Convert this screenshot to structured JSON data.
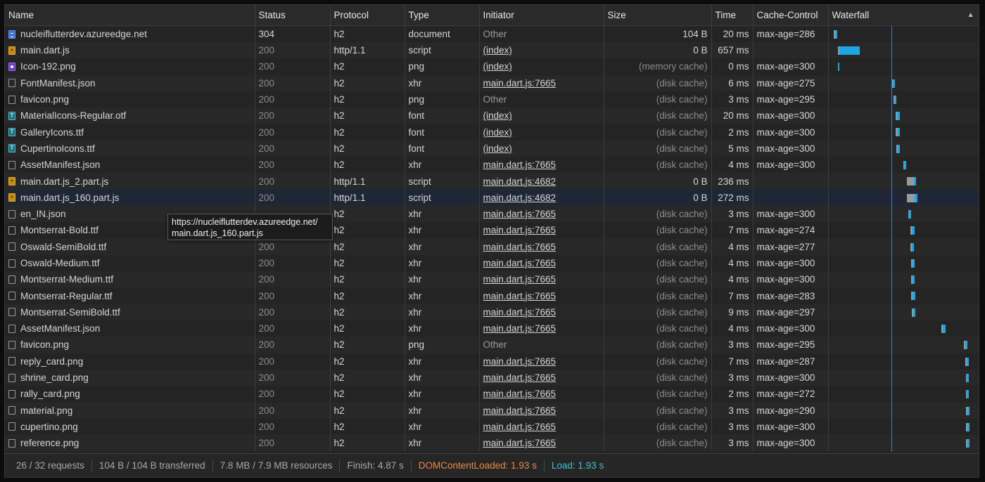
{
  "columns": [
    "Name",
    "Status",
    "Protocol",
    "Type",
    "Initiator",
    "Size",
    "Time",
    "Cache-Control",
    "Waterfall"
  ],
  "rows": [
    {
      "name": "nucleiflutterdev.azureedge.net",
      "icon": "doc",
      "status": "304",
      "protocol": "h2",
      "type": "document",
      "initiator": "Other",
      "init_link": false,
      "size": "104 B",
      "size_dim": false,
      "time": "20 ms",
      "cache": "max-age=286",
      "wf": [
        {
          "k": "wait",
          "s": 1182,
          "w": 2
        },
        {
          "k": "dl",
          "s": 1184,
          "w": 3
        }
      ]
    },
    {
      "name": "main.dart.js",
      "icon": "script",
      "status": "200",
      "protocol": "http/1.1",
      "type": "script",
      "initiator": "(index)",
      "init_link": true,
      "size": "0 B",
      "size_dim": false,
      "time": "657 ms",
      "cache": "",
      "wf": [
        {
          "k": "wait",
          "s": 1188,
          "w": 2
        },
        {
          "k": "dl",
          "s": 1190,
          "w": 29
        }
      ]
    },
    {
      "name": "Icon-192.png",
      "icon": "img",
      "status": "200",
      "protocol": "h2",
      "type": "png",
      "initiator": "(index)",
      "init_link": true,
      "size": "(memory cache)",
      "size_dim": true,
      "time": "0 ms",
      "cache": "max-age=300",
      "wf": [
        {
          "k": "dl",
          "s": 1188,
          "w": 2
        }
      ]
    },
    {
      "name": "FontManifest.json",
      "icon": "plain",
      "status": "200",
      "protocol": "h2",
      "type": "xhr",
      "initiator": "main.dart.js:7665",
      "init_link": true,
      "size": "(disk cache)",
      "size_dim": true,
      "time": "6 ms",
      "cache": "max-age=275",
      "wf": [
        {
          "k": "wait",
          "s": 1264,
          "w": 2
        },
        {
          "k": "dl",
          "s": 1266,
          "w": 3
        }
      ]
    },
    {
      "name": "favicon.png",
      "icon": "plain",
      "status": "200",
      "protocol": "h2",
      "type": "png",
      "initiator": "Other",
      "init_link": false,
      "size": "(disk cache)",
      "size_dim": true,
      "time": "3 ms",
      "cache": "max-age=295",
      "wf": [
        {
          "k": "wait",
          "s": 1267,
          "w": 2
        },
        {
          "k": "dl",
          "s": 1269,
          "w": 2
        }
      ]
    },
    {
      "name": "MaterialIcons-Regular.otf",
      "icon": "font",
      "status": "200",
      "protocol": "h2",
      "type": "font",
      "initiator": "(index)",
      "init_link": true,
      "size": "(disk cache)",
      "size_dim": true,
      "time": "20 ms",
      "cache": "max-age=300",
      "wf": [
        {
          "k": "wait",
          "s": 1270,
          "w": 2
        },
        {
          "k": "dl",
          "s": 1272,
          "w": 4
        }
      ]
    },
    {
      "name": "GalleryIcons.ttf",
      "icon": "font",
      "status": "200",
      "protocol": "h2",
      "type": "font",
      "initiator": "(index)",
      "init_link": true,
      "size": "(disk cache)",
      "size_dim": true,
      "time": "2 ms",
      "cache": "max-age=300",
      "wf": [
        {
          "k": "wait",
          "s": 1270,
          "w": 3
        },
        {
          "k": "dl",
          "s": 1273,
          "w": 3
        }
      ]
    },
    {
      "name": "CupertinoIcons.ttf",
      "icon": "font",
      "status": "200",
      "protocol": "h2",
      "type": "font",
      "initiator": "(index)",
      "init_link": true,
      "size": "(disk cache)",
      "size_dim": true,
      "time": "5 ms",
      "cache": "max-age=300",
      "wf": [
        {
          "k": "wait",
          "s": 1271,
          "w": 2
        },
        {
          "k": "dl",
          "s": 1273,
          "w": 3
        }
      ]
    },
    {
      "name": "AssetManifest.json",
      "icon": "plain",
      "status": "200",
      "protocol": "h2",
      "type": "xhr",
      "initiator": "main.dart.js:7665",
      "init_link": true,
      "size": "(disk cache)",
      "size_dim": true,
      "time": "4 ms",
      "cache": "max-age=300",
      "wf": [
        {
          "k": "wait",
          "s": 1281,
          "w": 1
        },
        {
          "k": "dl",
          "s": 1282,
          "w": 3
        }
      ]
    },
    {
      "name": "main.dart.js_2.part.js",
      "icon": "script",
      "status": "200",
      "protocol": "http/1.1",
      "type": "script",
      "initiator": "main.dart.js:4682",
      "init_link": true,
      "size": "0 B",
      "size_dim": false,
      "time": "236 ms",
      "cache": "",
      "wf": [
        {
          "k": "wait",
          "s": 1286,
          "w": 10
        },
        {
          "k": "dl",
          "s": 1296,
          "w": 3
        }
      ]
    },
    {
      "name": "main.dart.js_160.part.js",
      "icon": "script",
      "status": "200",
      "protocol": "http/1.1",
      "type": "script",
      "initiator": "main.dart.js:4682",
      "init_link": true,
      "size": "0 B",
      "size_dim": false,
      "time": "272 ms",
      "cache": "",
      "selected": true,
      "wf": [
        {
          "k": "wait",
          "s": 1286,
          "w": 11
        },
        {
          "k": "dl",
          "s": 1297,
          "w": 4
        }
      ]
    },
    {
      "name": "en_IN.json",
      "icon": "plain",
      "status": "",
      "protocol": "h2",
      "type": "xhr",
      "initiator": "main.dart.js:7665",
      "init_link": true,
      "size": "(disk cache)",
      "size_dim": true,
      "time": "3 ms",
      "cache": "max-age=300",
      "wf": [
        {
          "k": "wait",
          "s": 1288,
          "w": 1
        },
        {
          "k": "dl",
          "s": 1289,
          "w": 3
        }
      ]
    },
    {
      "name": "Montserrat-Bold.ttf",
      "icon": "plain",
      "status": "",
      "protocol": "h2",
      "type": "xhr",
      "initiator": "main.dart.js:7665",
      "init_link": true,
      "size": "(disk cache)",
      "size_dim": true,
      "time": "7 ms",
      "cache": "max-age=274",
      "wf": [
        {
          "k": "wait",
          "s": 1291,
          "w": 2
        },
        {
          "k": "dl",
          "s": 1293,
          "w": 4
        }
      ]
    },
    {
      "name": "Oswald-SemiBold.ttf",
      "icon": "plain",
      "status": "200",
      "protocol": "h2",
      "type": "xhr",
      "initiator": "main.dart.js:7665",
      "init_link": true,
      "size": "(disk cache)",
      "size_dim": true,
      "time": "4 ms",
      "cache": "max-age=277",
      "wf": [
        {
          "k": "wait",
          "s": 1291,
          "w": 2
        },
        {
          "k": "dl",
          "s": 1293,
          "w": 3
        }
      ]
    },
    {
      "name": "Oswald-Medium.ttf",
      "icon": "plain",
      "status": "200",
      "protocol": "h2",
      "type": "xhr",
      "initiator": "main.dart.js:7665",
      "init_link": true,
      "size": "(disk cache)",
      "size_dim": true,
      "time": "4 ms",
      "cache": "max-age=300",
      "wf": [
        {
          "k": "wait",
          "s": 1292,
          "w": 2
        },
        {
          "k": "dl",
          "s": 1294,
          "w": 3
        }
      ]
    },
    {
      "name": "Montserrat-Medium.ttf",
      "icon": "plain",
      "status": "200",
      "protocol": "h2",
      "type": "xhr",
      "initiator": "main.dart.js:7665",
      "init_link": true,
      "size": "(disk cache)",
      "size_dim": true,
      "time": "4 ms",
      "cache": "max-age=300",
      "wf": [
        {
          "k": "wait",
          "s": 1292,
          "w": 2
        },
        {
          "k": "dl",
          "s": 1294,
          "w": 3
        }
      ]
    },
    {
      "name": "Montserrat-Regular.ttf",
      "icon": "plain",
      "status": "200",
      "protocol": "h2",
      "type": "xhr",
      "initiator": "main.dart.js:7665",
      "init_link": true,
      "size": "(disk cache)",
      "size_dim": true,
      "time": "7 ms",
      "cache": "max-age=283",
      "wf": [
        {
          "k": "wait",
          "s": 1292,
          "w": 2
        },
        {
          "k": "dl",
          "s": 1294,
          "w": 4
        }
      ]
    },
    {
      "name": "Montserrat-SemiBold.ttf",
      "icon": "plain",
      "status": "200",
      "protocol": "h2",
      "type": "xhr",
      "initiator": "main.dart.js:7665",
      "init_link": true,
      "size": "(disk cache)",
      "size_dim": true,
      "time": "9 ms",
      "cache": "max-age=297",
      "wf": [
        {
          "k": "wait",
          "s": 1293,
          "w": 2
        },
        {
          "k": "dl",
          "s": 1295,
          "w": 3
        }
      ]
    },
    {
      "name": "AssetManifest.json",
      "icon": "plain",
      "status": "200",
      "protocol": "h2",
      "type": "xhr",
      "initiator": "main.dart.js:7665",
      "init_link": true,
      "size": "(disk cache)",
      "size_dim": true,
      "time": "4 ms",
      "cache": "max-age=300",
      "wf": [
        {
          "k": "wait",
          "s": 1335,
          "w": 2
        },
        {
          "k": "dl",
          "s": 1337,
          "w": 4
        }
      ]
    },
    {
      "name": "favicon.png",
      "icon": "plain",
      "status": "200",
      "protocol": "h2",
      "type": "png",
      "initiator": "Other",
      "init_link": false,
      "size": "(disk cache)",
      "size_dim": true,
      "time": "3 ms",
      "cache": "max-age=295",
      "wf": [
        {
          "k": "wait",
          "s": 1367,
          "w": 2
        },
        {
          "k": "dl",
          "s": 1369,
          "w": 3
        }
      ]
    },
    {
      "name": "reply_card.png",
      "icon": "plain",
      "status": "200",
      "protocol": "h2",
      "type": "xhr",
      "initiator": "main.dart.js:7665",
      "init_link": true,
      "size": "(disk cache)",
      "size_dim": true,
      "time": "7 ms",
      "cache": "max-age=287",
      "wf": [
        {
          "k": "wait",
          "s": 1369,
          "w": 2
        },
        {
          "k": "dl",
          "s": 1371,
          "w": 3
        }
      ]
    },
    {
      "name": "shrine_card.png",
      "icon": "plain",
      "status": "200",
      "protocol": "h2",
      "type": "xhr",
      "initiator": "main.dart.js:7665",
      "init_link": true,
      "size": "(disk cache)",
      "size_dim": true,
      "time": "3 ms",
      "cache": "max-age=300",
      "wf": [
        {
          "k": "wait",
          "s": 1370,
          "w": 1
        },
        {
          "k": "dl",
          "s": 1371,
          "w": 3
        }
      ]
    },
    {
      "name": "rally_card.png",
      "icon": "plain",
      "status": "200",
      "protocol": "h2",
      "type": "xhr",
      "initiator": "main.dart.js:7665",
      "init_link": true,
      "size": "(disk cache)",
      "size_dim": true,
      "time": "2 ms",
      "cache": "max-age=272",
      "wf": [
        {
          "k": "wait",
          "s": 1370,
          "w": 1
        },
        {
          "k": "dl",
          "s": 1371,
          "w": 3
        }
      ]
    },
    {
      "name": "material.png",
      "icon": "plain",
      "status": "200",
      "protocol": "h2",
      "type": "xhr",
      "initiator": "main.dart.js:7665",
      "init_link": true,
      "size": "(disk cache)",
      "size_dim": true,
      "time": "3 ms",
      "cache": "max-age=290",
      "wf": [
        {
          "k": "wait",
          "s": 1370,
          "w": 2
        },
        {
          "k": "dl",
          "s": 1372,
          "w": 3
        }
      ]
    },
    {
      "name": "cupertino.png",
      "icon": "plain",
      "status": "200",
      "protocol": "h2",
      "type": "xhr",
      "initiator": "main.dart.js:7665",
      "init_link": true,
      "size": "(disk cache)",
      "size_dim": true,
      "time": "3 ms",
      "cache": "max-age=300",
      "wf": [
        {
          "k": "wait",
          "s": 1370,
          "w": 2
        },
        {
          "k": "dl",
          "s": 1372,
          "w": 3
        }
      ]
    },
    {
      "name": "reference.png",
      "icon": "plain",
      "status": "200",
      "protocol": "h2",
      "type": "xhr",
      "initiator": "main.dart.js:7665",
      "init_link": true,
      "size": "(disk cache)",
      "size_dim": true,
      "time": "3 ms",
      "cache": "max-age=300",
      "wf": [
        {
          "k": "wait",
          "s": 1370,
          "w": 2
        },
        {
          "k": "dl",
          "s": 1372,
          "w": 3
        }
      ]
    }
  ],
  "tooltip": {
    "line1": "https://nucleiflutterdev.azureedge.net/",
    "line2": "main.dart.js_160.part.js"
  },
  "footer": {
    "requests": "26 / 32 requests",
    "transferred": "104 B / 104 B transferred",
    "resources": "7.8 MB / 7.9 MB resources",
    "finish": "Finish: 4.87 s",
    "dcl": "DOMContentLoaded: 1.93 s",
    "load": "Load: 1.93 s"
  },
  "colors": {
    "dcl": "#e88c4a",
    "load": "#3fc0d8",
    "waterfall_download": "#1ba7e4",
    "waterfall_wait": "#9a9a9a"
  },
  "icons": {
    "sort": "triangle-up-icon"
  }
}
